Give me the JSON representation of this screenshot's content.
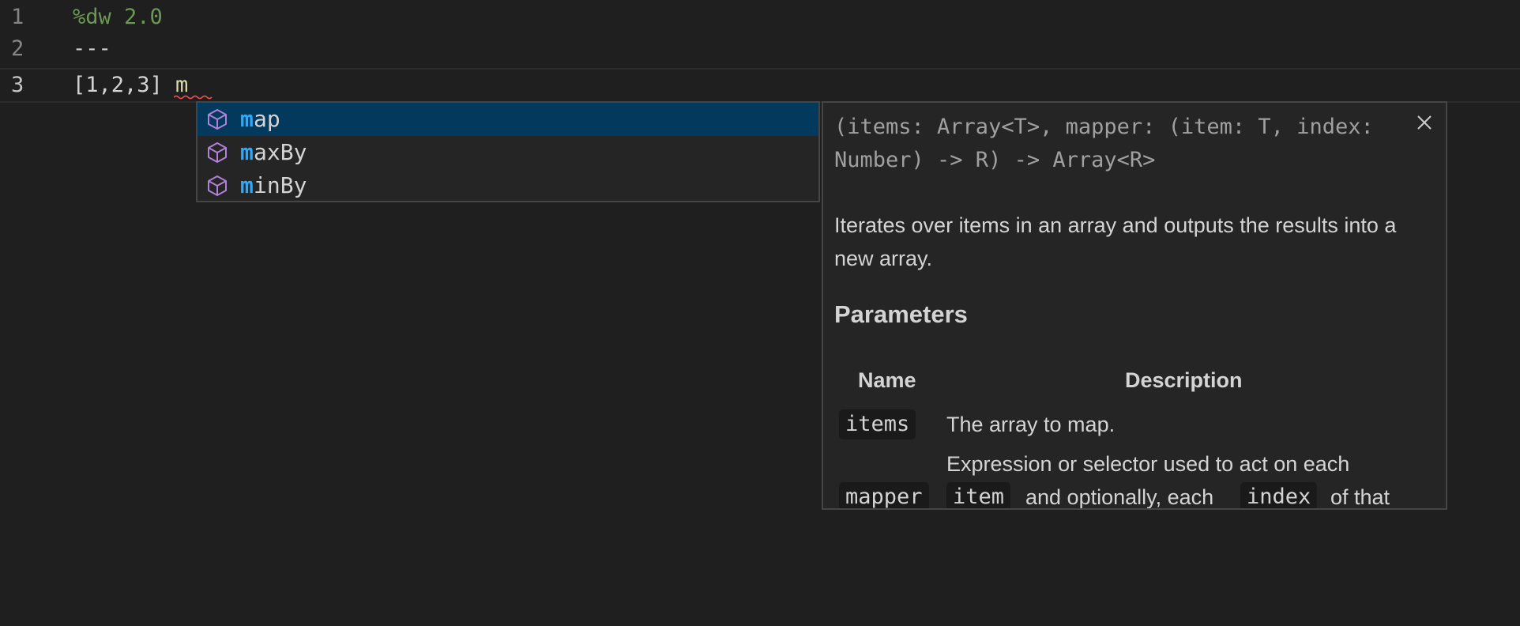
{
  "editor": {
    "lines": [
      {
        "number": "1",
        "text": "%dw 2.0"
      },
      {
        "number": "2",
        "text": "---"
      },
      {
        "number": "3",
        "bracket_text": "[1,2,3] ",
        "typed_token": "m"
      }
    ]
  },
  "suggest": {
    "items": [
      {
        "label": "map",
        "match": "m",
        "rest": "ap",
        "icon": "cube-icon",
        "selected": true
      },
      {
        "label": "maxBy",
        "match": "m",
        "rest": "axBy",
        "icon": "cube-icon",
        "selected": false
      },
      {
        "label": "minBy",
        "match": "m",
        "rest": "inBy",
        "icon": "cube-icon",
        "selected": false
      }
    ],
    "match_color": "#2aaaff",
    "icon_color": "#b180d7",
    "selected_bg": "#04395e"
  },
  "details": {
    "signature": "(items: Array<T>, mapper: (item: T, index: Number) -> R) -> Array<R>",
    "description": "Iterates over items in an array and outputs the results into a new array.",
    "parameters_heading": "Parameters",
    "table": {
      "headers": [
        "Name",
        "Description"
      ],
      "rows": [
        {
          "name": "items",
          "description": "The array to map."
        },
        {
          "name": "mapper",
          "description_line1": "Expression or selector used to act on each",
          "description_code1": "item",
          "description_mid": "and optionally, each",
          "description_code2": "index",
          "description_tail": "of that"
        }
      ]
    },
    "close_icon": "close-icon"
  }
}
